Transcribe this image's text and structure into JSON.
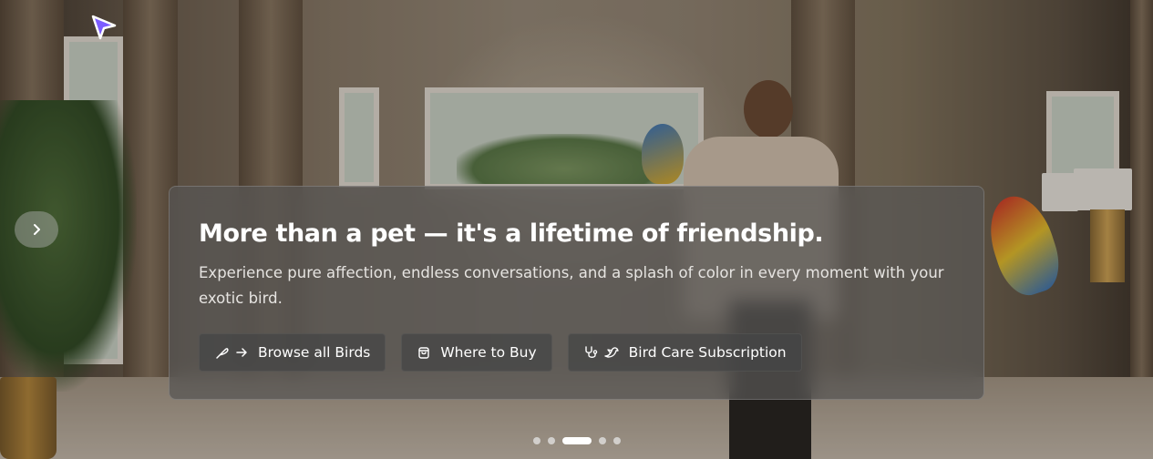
{
  "hero": {
    "title": "More than a pet — it's a lifetime of friendship.",
    "description": "Experience pure affection, endless conversations, and a splash of color in every moment with your exotic bird.",
    "accent_color": "#7c5cff"
  },
  "actions": [
    {
      "label": "Browse all Birds",
      "icons": [
        "feather-icon",
        "arrow-right-icon"
      ]
    },
    {
      "label": "Where to Buy",
      "icons": [
        "shopping-bag-icon"
      ]
    },
    {
      "label": "Bird Care Subscription",
      "icons": [
        "stethoscope-icon",
        "bird-icon"
      ]
    }
  ],
  "carousel": {
    "next_icon": "chevron-right-icon",
    "slide_count": 5,
    "active_slide": 3
  }
}
